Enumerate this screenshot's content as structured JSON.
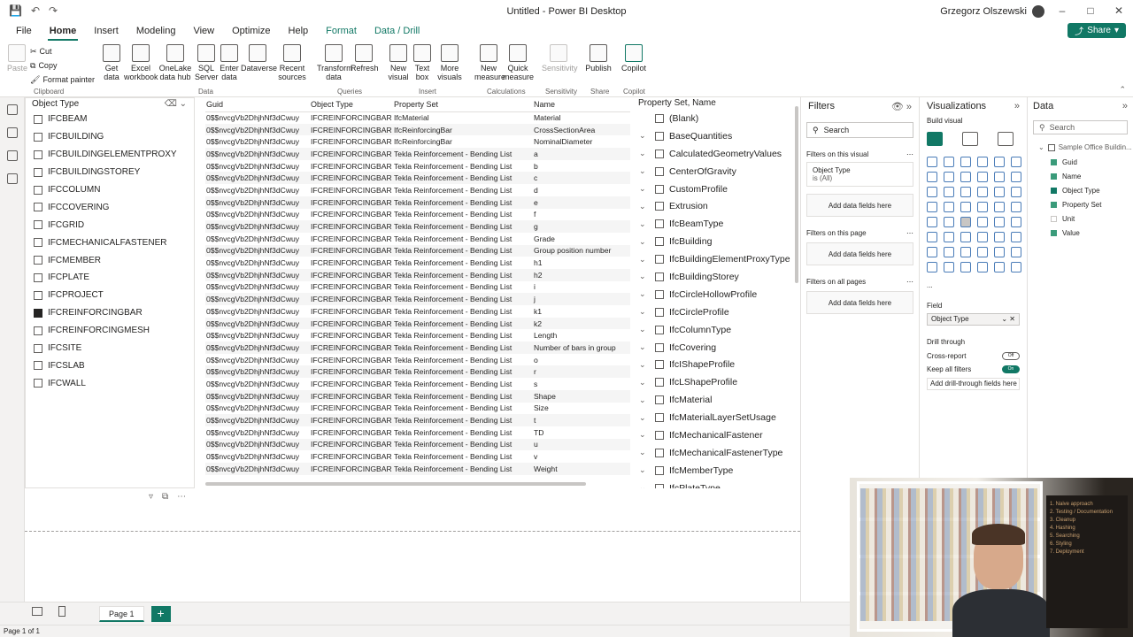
{
  "window": {
    "title": "Untitled - Power BI Desktop",
    "user": "Grzegorz Olszewski"
  },
  "tabs": [
    "File",
    "Home",
    "Insert",
    "Modeling",
    "View",
    "Optimize",
    "Help",
    "Format",
    "Data / Drill"
  ],
  "share_label": "Share",
  "ribbon": {
    "clipboard": {
      "paste": "Paste",
      "cut": "Cut",
      "copy": "Copy",
      "format_painter": "Format painter",
      "group": "Clipboard"
    },
    "data_buttons": [
      "Get data",
      "Excel workbook",
      "OneLake data hub",
      "SQL Server",
      "Enter data",
      "Dataverse",
      "Recent sources"
    ],
    "data_group": "Data",
    "query_buttons": [
      "Transform data",
      "Refresh"
    ],
    "query_group": "Queries",
    "insert_buttons": [
      "New visual",
      "Text box",
      "More visuals"
    ],
    "insert_group": "Insert",
    "calc_buttons": [
      "New measure",
      "Quick measure"
    ],
    "calc_group": "Calculations",
    "sensitivity": "Sensitivity",
    "sensitivity_group": "Sensitivity",
    "publish": "Publish",
    "share_group": "Share",
    "copilot": "Copilot",
    "copilot_group": "Copilot"
  },
  "slicer": {
    "title": "Object Type",
    "items": [
      {
        "label": "IFCBEAM",
        "checked": false
      },
      {
        "label": "IFCBUILDING",
        "checked": false
      },
      {
        "label": "IFCBUILDINGELEMENTPROXY",
        "checked": false
      },
      {
        "label": "IFCBUILDINGSTOREY",
        "checked": false
      },
      {
        "label": "IFCCOLUMN",
        "checked": false
      },
      {
        "label": "IFCCOVERING",
        "checked": false
      },
      {
        "label": "IFCGRID",
        "checked": false
      },
      {
        "label": "IFCMECHANICALFASTENER",
        "checked": false
      },
      {
        "label": "IFCMEMBER",
        "checked": false
      },
      {
        "label": "IFCPLATE",
        "checked": false
      },
      {
        "label": "IFCPROJECT",
        "checked": false
      },
      {
        "label": "IFCREINFORCINGBAR",
        "checked": true
      },
      {
        "label": "IFCREINFORCINGMESH",
        "checked": false
      },
      {
        "label": "IFCSITE",
        "checked": false
      },
      {
        "label": "IFCSLAB",
        "checked": false
      },
      {
        "label": "IFCWALL",
        "checked": false
      }
    ]
  },
  "table": {
    "headers": [
      "Guid",
      "Object Type",
      "Property Set",
      "Name"
    ],
    "guid": "0$$nvcgVb2DhjhNf3dCwuy",
    "object_type": "IFCREINFORCINGBAR",
    "rows": [
      {
        "pset": "IfcMaterial",
        "name": "Material"
      },
      {
        "pset": "IfcReinforcingBar",
        "name": "CrossSectionArea"
      },
      {
        "pset": "IfcReinforcingBar",
        "name": "NominalDiameter"
      },
      {
        "pset": "Tekla Reinforcement - Bending List",
        "name": "a"
      },
      {
        "pset": "Tekla Reinforcement - Bending List",
        "name": "b"
      },
      {
        "pset": "Tekla Reinforcement - Bending List",
        "name": "c"
      },
      {
        "pset": "Tekla Reinforcement - Bending List",
        "name": "d"
      },
      {
        "pset": "Tekla Reinforcement - Bending List",
        "name": "e"
      },
      {
        "pset": "Tekla Reinforcement - Bending List",
        "name": "f"
      },
      {
        "pset": "Tekla Reinforcement - Bending List",
        "name": "g"
      },
      {
        "pset": "Tekla Reinforcement - Bending List",
        "name": "Grade"
      },
      {
        "pset": "Tekla Reinforcement - Bending List",
        "name": "Group position number"
      },
      {
        "pset": "Tekla Reinforcement - Bending List",
        "name": "h1"
      },
      {
        "pset": "Tekla Reinforcement - Bending List",
        "name": "h2"
      },
      {
        "pset": "Tekla Reinforcement - Bending List",
        "name": "i"
      },
      {
        "pset": "Tekla Reinforcement - Bending List",
        "name": "j"
      },
      {
        "pset": "Tekla Reinforcement - Bending List",
        "name": "k1"
      },
      {
        "pset": "Tekla Reinforcement - Bending List",
        "name": "k2"
      },
      {
        "pset": "Tekla Reinforcement - Bending List",
        "name": "Length"
      },
      {
        "pset": "Tekla Reinforcement - Bending List",
        "name": "Number of bars in group"
      },
      {
        "pset": "Tekla Reinforcement - Bending List",
        "name": "o"
      },
      {
        "pset": "Tekla Reinforcement - Bending List",
        "name": "r"
      },
      {
        "pset": "Tekla Reinforcement - Bending List",
        "name": "s"
      },
      {
        "pset": "Tekla Reinforcement - Bending List",
        "name": "Shape"
      },
      {
        "pset": "Tekla Reinforcement - Bending List",
        "name": "Size"
      },
      {
        "pset": "Tekla Reinforcement - Bending List",
        "name": "t"
      },
      {
        "pset": "Tekla Reinforcement - Bending List",
        "name": "TD"
      },
      {
        "pset": "Tekla Reinforcement - Bending List",
        "name": "u"
      },
      {
        "pset": "Tekla Reinforcement - Bending List",
        "name": "v"
      },
      {
        "pset": "Tekla Reinforcement - Bending List",
        "name": "Weight"
      }
    ]
  },
  "pset_slicer": {
    "title": "Property Set, Name",
    "items": [
      {
        "label": "(Blank)",
        "expandable": false
      },
      {
        "label": "BaseQuantities",
        "expandable": true
      },
      {
        "label": "CalculatedGeometryValues",
        "expandable": true
      },
      {
        "label": "CenterOfGravity",
        "expandable": true
      },
      {
        "label": "CustomProfile",
        "expandable": true
      },
      {
        "label": "Extrusion",
        "expandable": true
      },
      {
        "label": "IfcBeamType",
        "expandable": true
      },
      {
        "label": "IfcBuilding",
        "expandable": true
      },
      {
        "label": "IfcBuildingElementProxyType",
        "expandable": true
      },
      {
        "label": "IfcBuildingStorey",
        "expandable": true
      },
      {
        "label": "IfcCircleHollowProfile",
        "expandable": true
      },
      {
        "label": "IfcCircleProfile",
        "expandable": true
      },
      {
        "label": "IfcColumnType",
        "expandable": true
      },
      {
        "label": "IfcCovering",
        "expandable": true
      },
      {
        "label": "IfcIShapeProfile",
        "expandable": true
      },
      {
        "label": "IfcLShapeProfile",
        "expandable": true
      },
      {
        "label": "IfcMaterial",
        "expandable": true
      },
      {
        "label": "IfcMaterialLayerSetUsage",
        "expandable": true
      },
      {
        "label": "IfcMechanicalFastener",
        "expandable": true
      },
      {
        "label": "IfcMechanicalFastenerType",
        "expandable": true
      },
      {
        "label": "IfcMemberType",
        "expandable": true
      },
      {
        "label": "IfcPlateType",
        "expandable": true
      }
    ]
  },
  "filters": {
    "title": "Filters",
    "search_placeholder": "Search",
    "on_visual": "Filters on this visual",
    "card_field": "Object Type",
    "card_value": "is (All)",
    "add": "Add data fields here",
    "on_page": "Filters on this page",
    "on_all": "Filters on all pages"
  },
  "visualizations": {
    "title": "Visualizations",
    "build": "Build visual",
    "field_label": "Field",
    "field_value": "Object Type",
    "drill": "Drill through",
    "cross_report": "Cross-report",
    "cross_report_state": "Off",
    "keep_filters": "Keep all filters",
    "keep_filters_state": "On",
    "add_drill": "Add drill-through fields here",
    "more": "..."
  },
  "data_pane": {
    "title": "Data",
    "search_placeholder": "Search",
    "table_name": "Sample Office Buildin...",
    "fields": [
      {
        "name": "Guid",
        "checked": false
      },
      {
        "name": "Name",
        "checked": false
      },
      {
        "name": "Object Type",
        "checked": true
      },
      {
        "name": "Property Set",
        "checked": false
      },
      {
        "name": "Unit",
        "checked": false
      },
      {
        "name": "Value",
        "checked": false
      }
    ]
  },
  "page_tab": "Page 1",
  "status": "Page 1 of 1",
  "webcam_board": [
    "1. Naive approach",
    "2. Testing / Documentation",
    "3. Cleanup",
    "4. Hashing",
    "5. Searching",
    "6. Styling",
    "7. Deployment"
  ],
  "colors": {
    "accent": "#117865",
    "checked": "#252423"
  }
}
